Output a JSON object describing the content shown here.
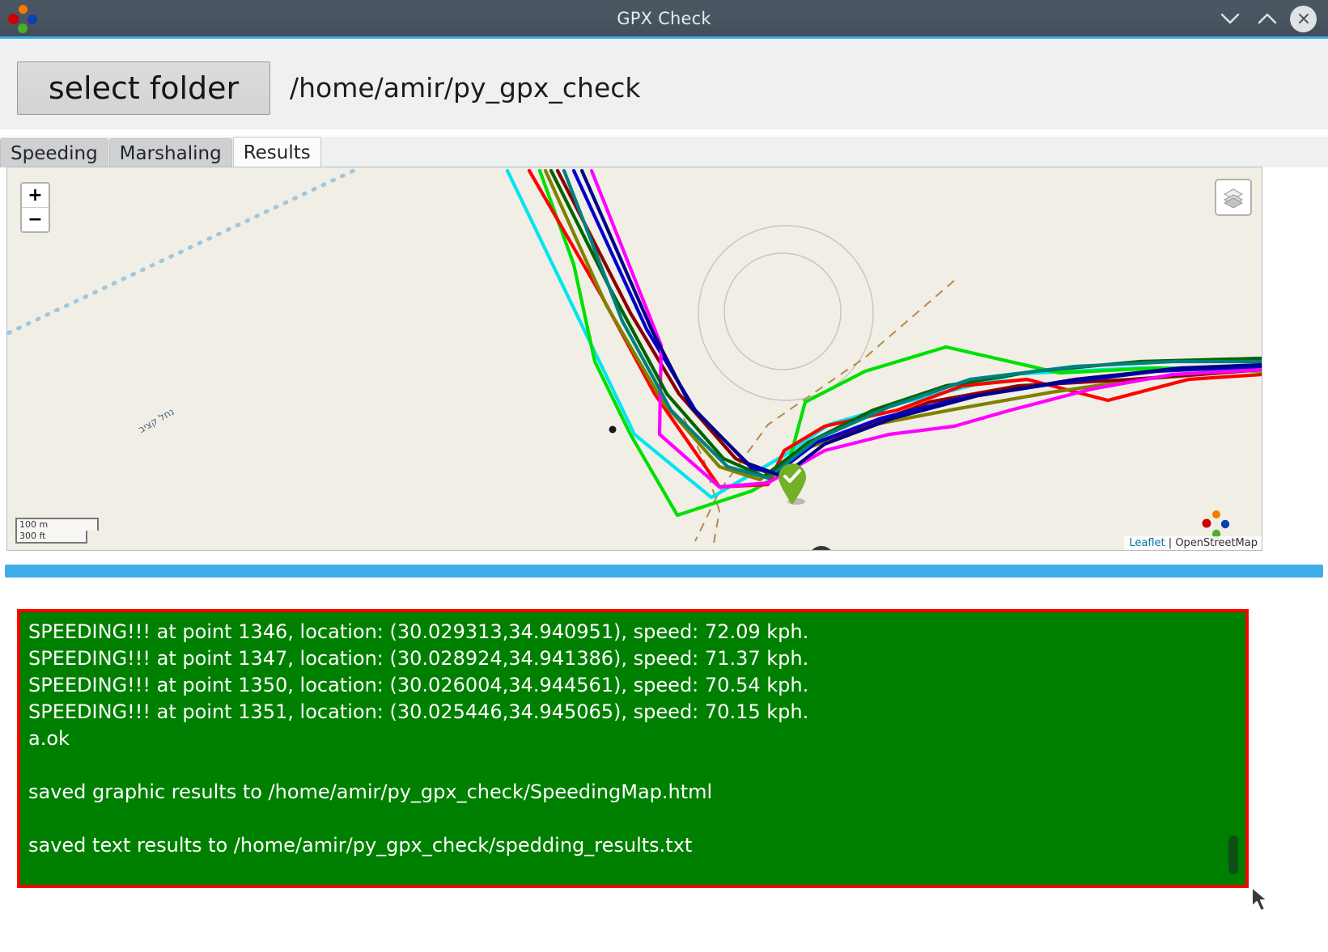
{
  "window": {
    "title": "GPX Check",
    "icon_name": "app-dots-icon",
    "controls": [
      {
        "name": "minimize",
        "glyph": "chevron-down-icon"
      },
      {
        "name": "maximize",
        "glyph": "chevron-up-icon"
      },
      {
        "name": "close",
        "glyph": "close-x-icon"
      }
    ],
    "accent_color": "#3daee9",
    "titlebar_color": "#495561"
  },
  "toolbar": {
    "select_folder_label": "select folder",
    "folder_path": "/home/amir/py_gpx_check"
  },
  "tabs": [
    {
      "label": "Speeding",
      "active": false
    },
    {
      "label": "Marshaling",
      "active": false
    },
    {
      "label": "Results",
      "active": true
    }
  ],
  "map": {
    "zoom_in_label": "+",
    "zoom_out_label": "−",
    "layers_icon": "layers-stack-icon",
    "scale_metric": "100 m",
    "scale_imperial": "300 ft",
    "attribution_leaflet": "Leaflet",
    "attribution_separator": " | ",
    "attribution_osm": "OpenStreetMap",
    "stream_label": "נחל קציב",
    "background_color": "#f1eee6",
    "marker_check_color": "#72b026",
    "marker_camera_color": "#383838",
    "track_colors": [
      "#00ffff",
      "#00e000",
      "#ff0000",
      "#808000",
      "#8b0000",
      "#0000cd",
      "#ff00ff",
      "#006400",
      "#008080",
      "#00008b"
    ],
    "camera_marker_count": 7,
    "check_marker_count": 1
  },
  "progress": {
    "percent": 100,
    "color": "#3daee9"
  },
  "results": {
    "border_color": "#ff0000",
    "background_color": "#008000",
    "text_color": "#ffffff",
    "lines": [
      "SPEEDING!!! at point 1346, location: (30.029313,34.940951), speed: 72.09 kph.",
      "SPEEDING!!! at point 1347, location: (30.028924,34.941386), speed: 71.37 kph.",
      "SPEEDING!!! at point 1350, location: (30.026004,34.944561), speed: 70.54 kph.",
      "SPEEDING!!! at point 1351, location: (30.025446,34.945065), speed: 70.15 kph.",
      "a.ok",
      "",
      "saved graphic results to /home/amir/py_gpx_check/SpeedingMap.html",
      "",
      "saved text results to /home/amir/py_gpx_check/spedding_results.txt"
    ]
  }
}
